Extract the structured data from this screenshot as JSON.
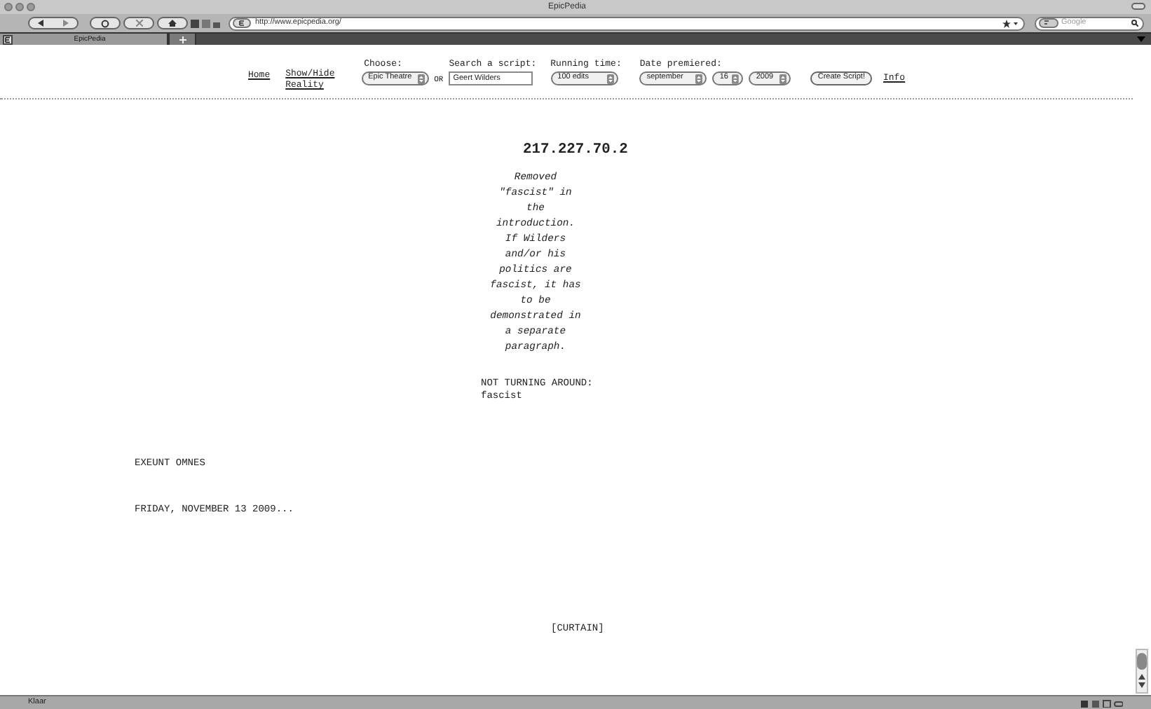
{
  "window": {
    "title": "EpicPedia"
  },
  "toolbar": {
    "address": "http://www.epicpedia.org/",
    "search_placeholder": "Google"
  },
  "tabs": [
    {
      "label": "EpicPedia",
      "selected": true
    }
  ],
  "header": {
    "links": [
      "Home",
      "Show/Hide Reality"
    ],
    "choose": {
      "label": "Choose:",
      "value": "Epic Theatre"
    },
    "or": "OR",
    "search": {
      "label": "Search a script:",
      "value": "Geert Wilders"
    },
    "running_time": {
      "label": "Running time:",
      "value": "100 edits"
    },
    "date": {
      "label": "Date premiered:",
      "month": "september",
      "day": "16",
      "year": "2009"
    },
    "button": "Create Script!",
    "info": "Info"
  },
  "script": {
    "title": "217.227.70.2",
    "summary": "Removed \"fascist\" in the introduction. If Wilders and/or his politics are fascist, it has to be demonstrated in a separate paragraph.",
    "not_turning_around": "NOT TURNING AROUND:",
    "word": "fascist",
    "exeunt": "EXEUNT OMNES",
    "date": "FRIDAY, NOVEMBER 13 2009...",
    "curtain": "[CURTAIN]"
  },
  "status_bar": "Klaar"
}
